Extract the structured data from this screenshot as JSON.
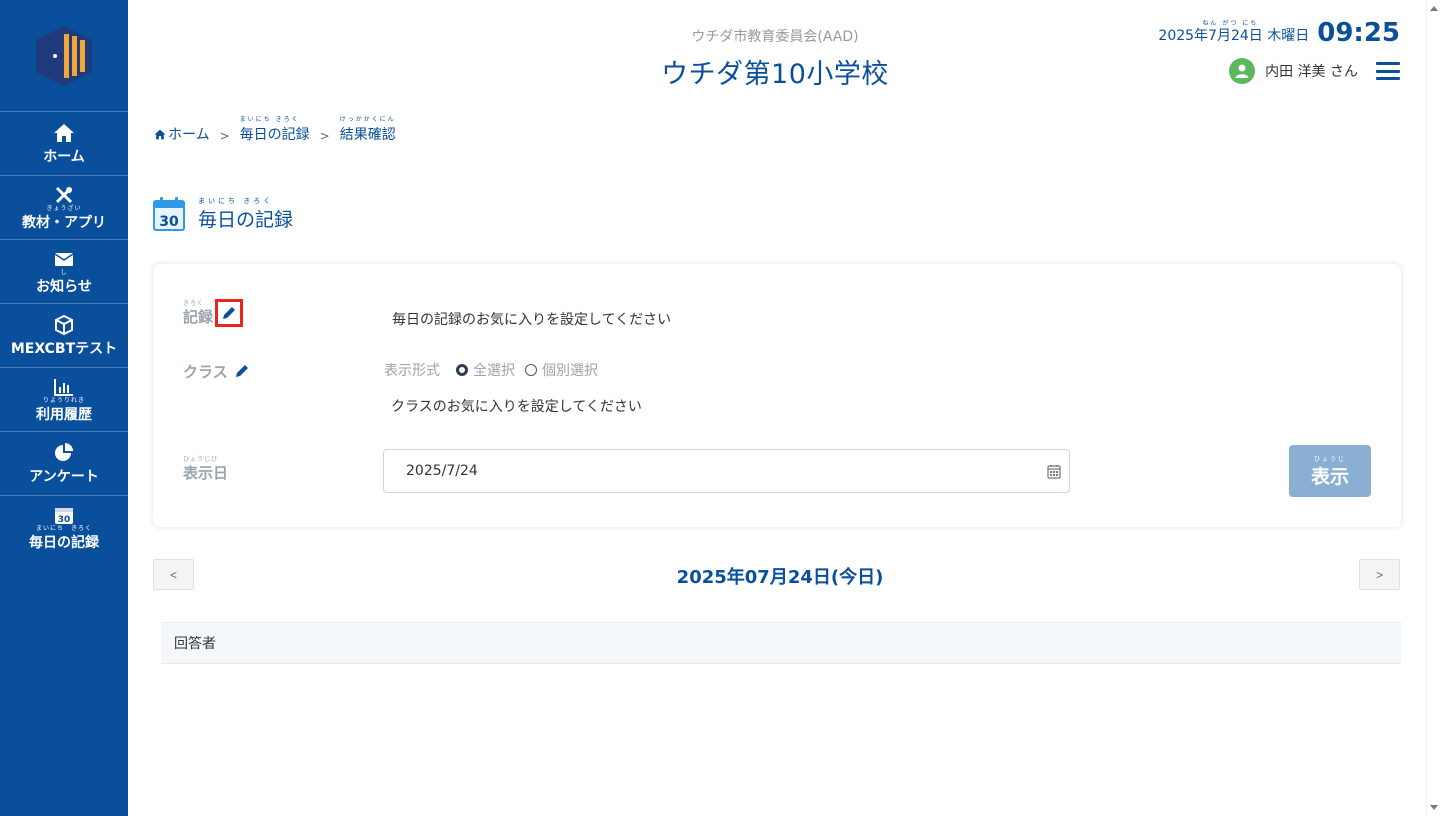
{
  "sidebar": {
    "items": [
      {
        "label": "ホーム",
        "ruby": "",
        "icon": "home-icon"
      },
      {
        "label": "教材・アプリ",
        "ruby": "きょうざい",
        "icon": "tools-icon"
      },
      {
        "label": "お知らせ",
        "ruby": "し",
        "icon": "mail-icon"
      },
      {
        "label": "MEXCBTテスト",
        "ruby": "",
        "icon": "cube-icon"
      },
      {
        "label": "利用履歴",
        "ruby": "りようりれき",
        "icon": "chart-icon"
      },
      {
        "label": "アンケート",
        "ruby": "",
        "icon": "pie-icon"
      },
      {
        "label": "毎日の記録",
        "ruby": "まいにち　きろく",
        "icon": "calendar-icon"
      }
    ]
  },
  "header": {
    "org": "ウチダ市教育委員会(AAD)",
    "school": "ウチダ第10小学校",
    "date": "2025年7月24日 木曜日",
    "date_ruby": "ねん がつ にち",
    "time": "09:25",
    "user": "内田 洋美 さん"
  },
  "breadcrumb": {
    "home": "ホーム",
    "item2": "毎日の記録",
    "item2_ruby": "まいにち きろく",
    "item3": "結果確認",
    "item3_ruby": "けっかかくにん",
    "sep": ">"
  },
  "page": {
    "title": "毎日の記録",
    "title_ruby": "まいにち きろく",
    "cal_day": "30"
  },
  "form": {
    "record_label": "記録",
    "record_ruby": "きろく",
    "record_text": "毎日の記録のお気に入りを設定してください",
    "class_label": "クラス",
    "display_format_label": "表示形式",
    "radio_all": "全選択",
    "radio_individual": "個別選択",
    "class_text": "クラスのお気に入りを設定してください",
    "date_label": "表示日",
    "date_ruby": "ひょうじび",
    "date_value": "2025/7/24",
    "show_button": "表示",
    "show_button_ruby": "ひょうじ"
  },
  "date_nav": {
    "prev": "<",
    "next": ">",
    "current": "2025年07月24日(今日)"
  },
  "table": {
    "header": "回答者"
  },
  "colors": {
    "primary": "#0a4f9c",
    "accent_highlight": "#e8261c",
    "button": "#8aafd3",
    "avatar": "#5cb85c"
  }
}
